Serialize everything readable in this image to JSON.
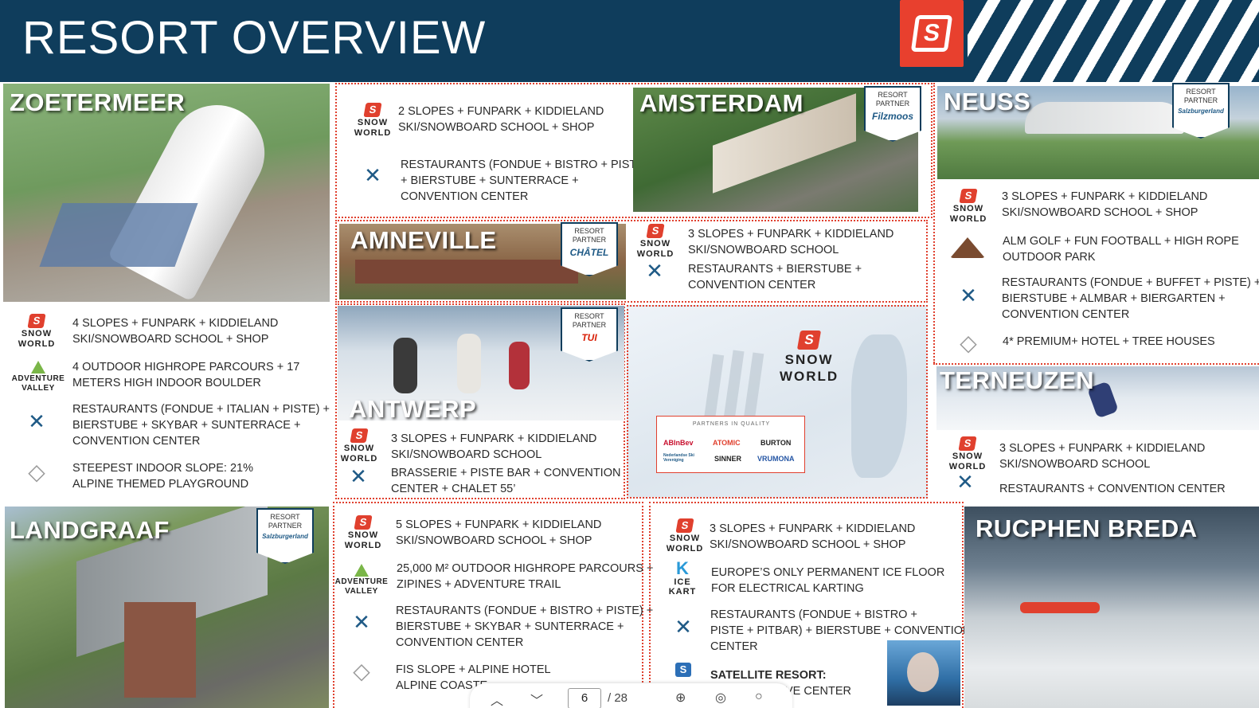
{
  "header": {
    "title": "RESORT OVERVIEW"
  },
  "badge": {
    "resort": "RESORT",
    "partner": "PARTNER"
  },
  "icons": {
    "snow_world_label": "SNOW\nWORLD",
    "adventure_valley_label": "ADVENTURE\nVALLEY",
    "ice_kart_letter": "K",
    "ice_kart_label": "ICE\nKART"
  },
  "zoetermeer": {
    "name": "ZOETERMEER",
    "lines": [
      "4 SLOPES + FUNPARK + KIDDIELAND",
      "SKI/SNOWBOARD SCHOOL + SHOP",
      "4 OUTDOOR HIGHROPE PARCOURS + 17",
      "METERS HIGH INDOOR BOULDER",
      "RESTAURANTS (FONDUE + ITALIAN + PISTE) +",
      "BIERSTUBE + SKYBAR + SUNTERRACE +",
      "CONVENTION CENTER",
      "STEEPEST INDOOR SLOPE: 21%",
      "ALPINE THEMED PLAYGROUND"
    ]
  },
  "amsterdam": {
    "name": "AMSTERDAM",
    "partner": "Filzmoos",
    "lines": [
      "2 SLOPES + FUNPARK + KIDDIELAND",
      "SKI/SNOWBOARD SCHOOL + SHOP",
      "RESTAURANTS (FONDUE + BISTRO + PISTE)",
      "+ BIERSTUBE +  SUNTERRACE +",
      "CONVENTION CENTER"
    ]
  },
  "amneville": {
    "name": "AMNEVILLE",
    "partner": "CHÂTEL",
    "lines": [
      "3 SLOPES + FUNPARK + KIDDIELAND",
      "SKI/SNOWBOARD SCHOOL",
      "RESTAURANTS  +  BIERSTUBE +",
      "CONVENTION CENTER"
    ]
  },
  "antwerp": {
    "name": "ANTWERP",
    "partner": "TUI",
    "lines": [
      "3 SLOPES + FUNPARK + KIDDIELAND",
      "SKI/SNOWBOARD SCHOOL",
      "BRASSERIE  +  PISTE BAR + CONVENTION",
      "CENTER + CHALET 55’"
    ]
  },
  "map": {
    "brand": "SNOW\nWORLD",
    "partners_title": "PARTNERS IN QUALITY",
    "partner_logos": [
      "ABInBev",
      "ATOMIC",
      "BURTON",
      "Nederlandse Ski Vereniging",
      "SINNER",
      "VRUMONA"
    ]
  },
  "neuss": {
    "name": "NEUSS",
    "partner": "Salzburgerland",
    "lines": [
      "3 SLOPES + FUNPARK + KIDDIELAND",
      "SKI/SNOWBOARD SCHOOL + SHOP",
      "ALM GOLF + FUN FOOTBALL + HIGH ROPE",
      "OUTDOOR PARK",
      "RESTAURANTS (FONDUE + BUFFET + PISTE) +",
      "BIERSTUBE + ALMBAR + BIERGARTEN +",
      "CONVENTION CENTER",
      "4* PREMIUM+ HOTEL + TREE HOUSES"
    ]
  },
  "terneuzen": {
    "name": "TERNEUZEN",
    "lines": [
      "3 SLOPES + FUNPARK + KIDDIELAND",
      "SKI/SNOWBOARD SCHOOL",
      "RESTAURANTS  +  CONVENTION CENTER"
    ]
  },
  "landgraaf": {
    "name": "LANDGRAAF",
    "partner": "Salzburgerland",
    "lines": [
      "5 SLOPES + FUNPARK + KIDDIELAND",
      "SKI/SNOWBOARD SCHOOL + SHOP",
      "25,000 M² OUTDOOR HIGHROPE PARCOURS +",
      "ZIPINES + ADVENTURE TRAIL",
      "RESTAURANTS (FONDUE + BISTRO + PISTE) +",
      "BIERSTUBE + SKYBAR + SUNTERRACE +",
      "CONVENTION CENTER",
      "FIS SLOPE + ALPINE HOTEL",
      "ALPINE COASTE"
    ]
  },
  "rucphen": {
    "name": "RUCPHEN BREDA",
    "lines": [
      "3 SLOPES + FUNPARK + KIDDIELAND",
      "SKI/SNOWBOARD SCHOOL + SHOP",
      "EUROPE’S ONLY PERMANENT ICE FLOOR",
      "FOR ELECTRICAL KARTING",
      "RESTAURANTS (FONDUE + BISTRO +",
      "PISTE + PITBAR) + BIERSTUBE +  CONVENTION",
      "CENTER",
      "SATELLITE RESORT:",
      "VE CENTER"
    ]
  },
  "pager": {
    "current": "6",
    "total": "/ 28"
  },
  "colors": {
    "navy": "#0f3d5c",
    "brand_red": "#e0402e",
    "text": "#2a2a2a"
  }
}
